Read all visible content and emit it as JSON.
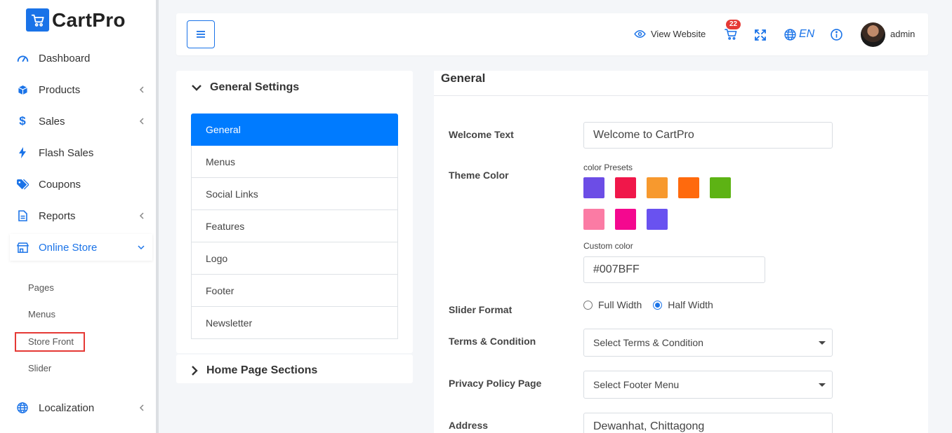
{
  "brand": {
    "name": "CartPro",
    "color": "#1a73e8"
  },
  "sidebar": {
    "items": [
      {
        "label": "Dashboard",
        "icon": "speedometer-icon",
        "has_children": false
      },
      {
        "label": "Products",
        "icon": "box-icon",
        "has_children": true
      },
      {
        "label": "Sales",
        "icon": "dollar-icon",
        "has_children": true
      },
      {
        "label": "Flash Sales",
        "icon": "bolt-icon",
        "has_children": false
      },
      {
        "label": "Coupons",
        "icon": "tags-icon",
        "has_children": false
      },
      {
        "label": "Reports",
        "icon": "file-icon",
        "has_children": true
      },
      {
        "label": "Online Store",
        "icon": "store-icon",
        "has_children": true,
        "expanded": true,
        "active": true
      },
      {
        "label": "Localization",
        "icon": "globe-icon",
        "has_children": true
      }
    ],
    "online_store_sub": [
      "Pages",
      "Menus",
      "Store Front",
      "Slider"
    ],
    "highlighted_sub": "Store Front"
  },
  "topbar": {
    "view_website": "View Website",
    "cart_count": "22",
    "language": "EN",
    "user": "admin"
  },
  "settings": {
    "general_heading": "General Settings",
    "menu": [
      "General",
      "Menus",
      "Social Links",
      "Features",
      "Logo",
      "Footer",
      "Newsletter"
    ],
    "active_menu": "General",
    "home_heading": "Home Page Sections"
  },
  "form": {
    "title": "General",
    "welcome_label": "Welcome Text",
    "welcome_value": "Welcome to CartPro",
    "theme_label": "Theme Color",
    "presets_label": "color Presets",
    "presets": [
      "#6c4de6",
      "#f0174a",
      "#f7992e",
      "#ff6a0d",
      "#5db314",
      "#fb7ba4",
      "#f4088f",
      "#6952f0"
    ],
    "custom_label": "Custom color",
    "custom_value": "#007BFF",
    "slider_label": "Slider Format",
    "slider_options": [
      "Full Width",
      "Half Width"
    ],
    "slider_selected": "Half Width",
    "terms_label": "Terms & Condition",
    "terms_value": "Select Terms & Condition",
    "privacy_label": "Privacy Policy Page",
    "privacy_value": "Select Footer Menu",
    "address_label": "Address",
    "address_value": "Dewanhat, Chittagong"
  }
}
